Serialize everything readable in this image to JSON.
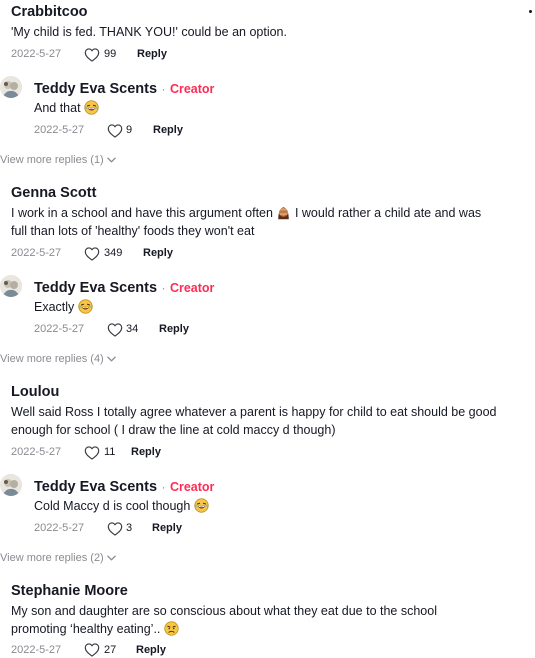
{
  "comments": [
    {
      "author": "Crabbitcoo",
      "text": "'My child is fed. THANK YOU!' could be an option.",
      "date": "2022-5-27",
      "likes": "99",
      "reply_label": "Reply",
      "replies": [
        {
          "author": "Teddy Eva Scents",
          "badge": "Creator",
          "text": "And that",
          "emoji": "laughing-emoji",
          "date": "2022-5-27",
          "likes": "9",
          "reply_label": "Reply"
        }
      ],
      "view_more": "View more replies (1)"
    },
    {
      "author": "Genna Scott",
      "text_part1": "I work in a school and have this argument often",
      "emoji": "facepalm-emoji",
      "text_part2": "I would rather a child ate and was",
      "text_line2": "full than lots of 'healthy' foods they won't eat",
      "date": "2022-5-27",
      "likes": "349",
      "reply_label": "Reply",
      "replies": [
        {
          "author": "Teddy Eva Scents",
          "badge": "Creator",
          "text": "Exactly",
          "emoji": "laughing-emoji",
          "date": "2022-5-27",
          "likes": "34",
          "reply_label": "Reply"
        }
      ],
      "view_more": "View more replies (4)"
    },
    {
      "author": "Loulou",
      "text_line1": "Well said Ross I totally agree whatever a parent is happy for child to eat should be good",
      "text_line2": "enough for school ( I draw the line at cold maccy d though)",
      "date": "2022-5-27",
      "likes": "11",
      "reply_label": "Reply",
      "replies": [
        {
          "author": "Teddy Eva Scents",
          "badge": "Creator",
          "text": "Cold Maccy d is cool though",
          "emoji": "laughing-emoji",
          "date": "2022-5-27",
          "likes": "3",
          "reply_label": "Reply"
        }
      ],
      "view_more": "View more replies (2)"
    },
    {
      "author": "Stephanie Moore",
      "text_line1": "My son and daughter are so conscious about what they eat due to the school",
      "text_line2": "promoting ‘healthy eating’..",
      "emoji": "disappointed-emoji",
      "date": "2022-5-27",
      "likes": "27",
      "reply_label": "Reply"
    }
  ],
  "separator": "·",
  "colors": {
    "creator": "#fe2c55",
    "meta": "#8a8b91",
    "text": "#161823",
    "emoji": "#f7c644"
  }
}
